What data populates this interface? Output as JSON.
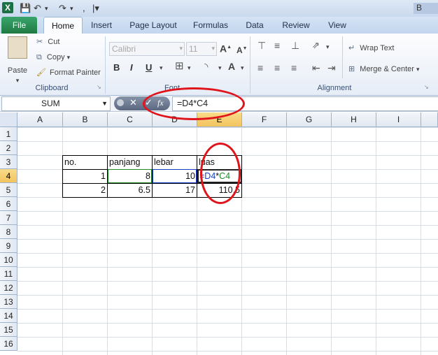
{
  "title_bar": {
    "title_tail": "B"
  },
  "tabs": [
    "File",
    "Home",
    "Insert",
    "Page Layout",
    "Formulas",
    "Data",
    "Review",
    "View"
  ],
  "clipboard": {
    "paste": "Paste",
    "cut": "Cut",
    "copy": "Copy",
    "format_painter": "Format Painter",
    "group": "Clipboard"
  },
  "font": {
    "font_name": "Calibri",
    "font_size": "11",
    "bold": "B",
    "italic": "I",
    "underline": "U",
    "group": "Font"
  },
  "alignment": {
    "wrap_text": "Wrap Text",
    "merge_center": "Merge & Center",
    "group": "Alignment"
  },
  "formula_bar": {
    "name_box": "SUM",
    "cancel": "✕",
    "enter": "✓",
    "fx": "fx",
    "formula": "=D4*C4"
  },
  "columns": [
    "A",
    "B",
    "C",
    "D",
    "E",
    "F",
    "G",
    "H",
    "I"
  ],
  "rows": [
    "1",
    "2",
    "3",
    "4",
    "5",
    "6",
    "7",
    "8",
    "9",
    "10",
    "11",
    "12",
    "13",
    "14",
    "15",
    "16"
  ],
  "table": {
    "headers": [
      "no.",
      "panjang",
      "lebar",
      "luas"
    ],
    "row1": {
      "no": "1",
      "panjang": "8",
      "lebar": "10",
      "luas_d4": "=D4",
      "luas_op": "*",
      "luas_c4": "C4"
    },
    "row2": {
      "no": "2",
      "panjang": "6.5",
      "lebar": "17",
      "luas": "110.5"
    }
  },
  "colors": {
    "annotation": "#e0141b",
    "ref_d4": "#1a3fc7",
    "ref_c4": "#1e8a2c",
    "active_header": "#f2c35e"
  }
}
